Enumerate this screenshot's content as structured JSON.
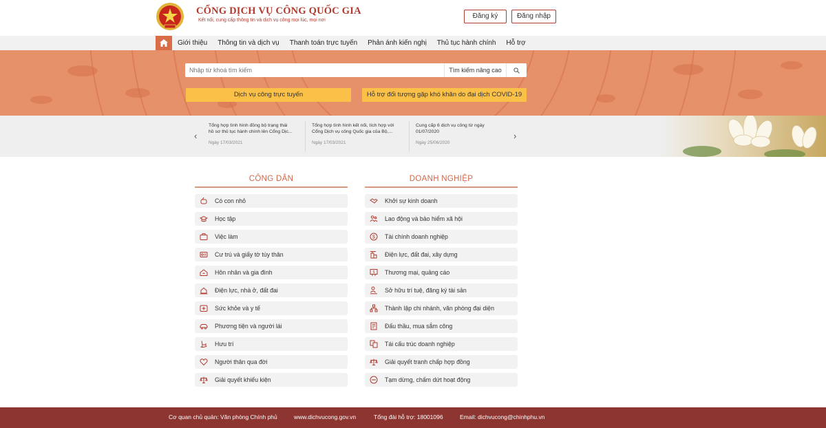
{
  "header": {
    "title": "CỔNG DỊCH VỤ CÔNG QUỐC GIA",
    "subtitle": "Kết nối, cung cấp thông tin và dịch vụ công mọi lúc, mọi nơi",
    "register_label": "Đăng ký",
    "login_label": "Đăng nhập",
    "emblem_icon": "national-emblem-icon"
  },
  "nav": {
    "home_icon": "home-icon",
    "items": [
      "Giới thiệu",
      "Thông tin và dịch vụ",
      "Thanh toán trực tuyến",
      "Phản ánh kiến nghị",
      "Thủ tục hành chính",
      "Hỗ trợ"
    ]
  },
  "search": {
    "placeholder": "Nhập từ khoá tìm kiếm",
    "advanced_label": "Tìm kiếm nâng cao",
    "button_icon": "search-icon"
  },
  "banner_buttons": {
    "online_services": "Dịch vụ công trực tuyến",
    "covid_support": "Hỗ trợ đối tượng gặp khó khăn do đại dịch COVID-19"
  },
  "news": {
    "items": [
      {
        "title_line1": "Tổng hợp tình hình đồng bộ trạng thái",
        "title_line2": "hồ sơ thủ tục hành chính lên Cổng Dịc...",
        "date": "Ngày 17/03/2021"
      },
      {
        "title_line1": "Tổng hợp tình hình kết nối, tích hợp với",
        "title_line2": "Cổng Dịch vụ công Quốc gia của Bộ,...",
        "date": "Ngày 17/03/2021"
      },
      {
        "title_line1": "Cung cấp 6 dịch vụ công từ ngày",
        "title_line2": "01/07/2020",
        "date": "Ngày 25/06/2020"
      }
    ],
    "prev_arrow": "‹",
    "next_arrow": "›"
  },
  "citizen": {
    "title": "CÔNG DÂN",
    "items": [
      "Có con nhỏ",
      "Học tập",
      "Việc làm",
      "Cư trú và giấy tờ tùy thân",
      "Hôn nhân và gia đình",
      "Điện lực, nhà ở, đất đai",
      "Sức khỏe và y tế",
      "Phương tiện và người lái",
      "Hưu trí",
      "Người thân qua đời",
      "Giải quyết khiếu kiện"
    ]
  },
  "business": {
    "title": "DOANH NGHIỆP",
    "items": [
      "Khởi sự kinh doanh",
      "Lao động và bảo hiểm xã hội",
      "Tài chính doanh nghiệp",
      "Điện lực, đất đai, xây dựng",
      "Thương mại, quảng cáo",
      "Sở hữu trí tuệ, đăng ký tài sản",
      "Thành lập chi nhánh, văn phòng đại diện",
      "Đấu thầu, mua sắm công",
      "Tái cấu trúc doanh nghiệp",
      "Giải quyết tranh chấp hợp đồng",
      "Tạm dừng, chấm dứt hoạt động"
    ]
  },
  "footer": {
    "agency": "Cơ quan chủ quản: Văn phòng Chính phủ",
    "website": "www.dichvucong.gov.vn",
    "hotline": "Tổng đài hỗ trợ: 18001096",
    "email": "Email: dichvucong@chinhphu.vn"
  },
  "colors": {
    "brand": "#b03a2e",
    "banner": "#e7916b",
    "accent_button": "#fbc048",
    "footer": "#8c3531"
  }
}
